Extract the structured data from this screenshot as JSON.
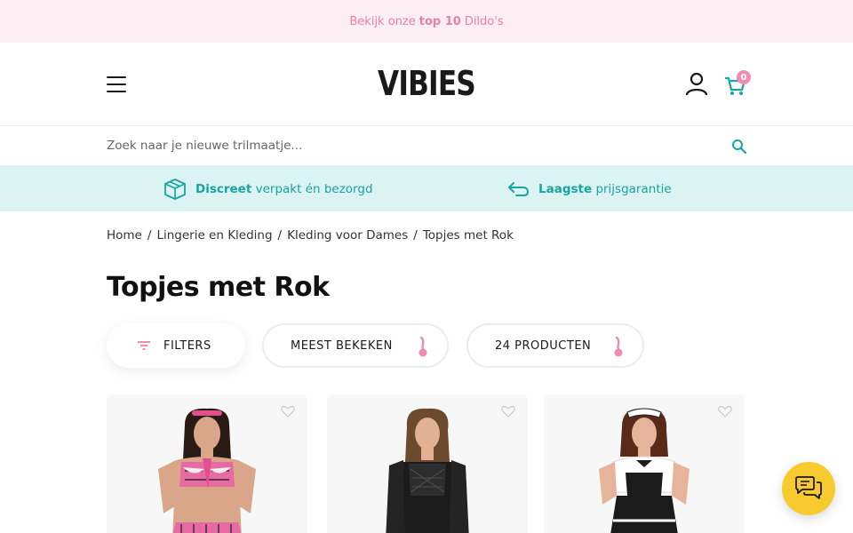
{
  "promo": {
    "prefix": "Bekijk onze",
    "highlight": "top 10",
    "suffix": "Dildo's"
  },
  "header": {
    "logo": "VIBIES",
    "cart_count": "0"
  },
  "search": {
    "placeholder": "Zoek naar je nieuwe trilmaatje..."
  },
  "usp": [
    {
      "bold": "Discreet",
      "text": "verpakt én bezorgd",
      "icon": "package-icon"
    },
    {
      "bold": "Laagste",
      "text": "prijsgarantie",
      "icon": "return-arrow-icon"
    }
  ],
  "breadcrumb": [
    "Home",
    "Lingerie en Kleding",
    "Kleding voor Dames",
    "Topjes met Rok"
  ],
  "page": {
    "title": "Topjes met Rok"
  },
  "toolbar": {
    "filters_label": "FILTERS",
    "sort_label": "MEEST BEKEKEN",
    "count_label": "24 PRODUCTEN"
  },
  "colors": {
    "accent_pink": "#f08bb3",
    "accent_teal": "#17a5a2",
    "chat_yellow": "#f7cb30"
  }
}
